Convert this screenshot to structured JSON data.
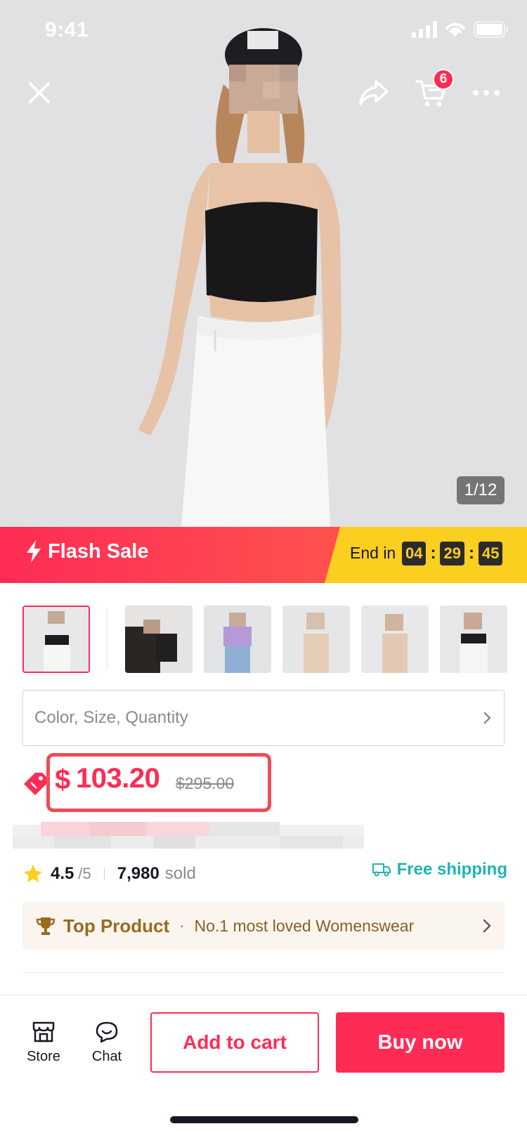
{
  "status_bar": {
    "time": "9:41"
  },
  "top_nav": {
    "cart_count": "6"
  },
  "gallery": {
    "counter": "1/12"
  },
  "flash_sale": {
    "title": "Flash Sale",
    "end_label": "End in",
    "hours": "04",
    "minutes": "29",
    "seconds": "45"
  },
  "variant_selector": {
    "label": "Color, Size, Quantity"
  },
  "price": {
    "currency": "$",
    "current": "103.20",
    "original": "$295.00"
  },
  "rating": {
    "value": "4.5",
    "max": "/5",
    "sold_count": "7,980",
    "sold_label": "sold"
  },
  "shipping": {
    "label": "Free shipping"
  },
  "top_product": {
    "title": "Top Product",
    "separator": "·",
    "description": "No.1 most loved Womenswear"
  },
  "bottom_bar": {
    "store_label": "Store",
    "chat_label": "Chat",
    "add_to_cart_label": "Add to cart",
    "buy_now_label": "Buy now"
  },
  "colors": {
    "accent": "#fe2c55",
    "flash_yellow": "#fbcf1f",
    "shipping_teal": "#1fb5b0",
    "top_product_gold": "#9a6a1f"
  }
}
